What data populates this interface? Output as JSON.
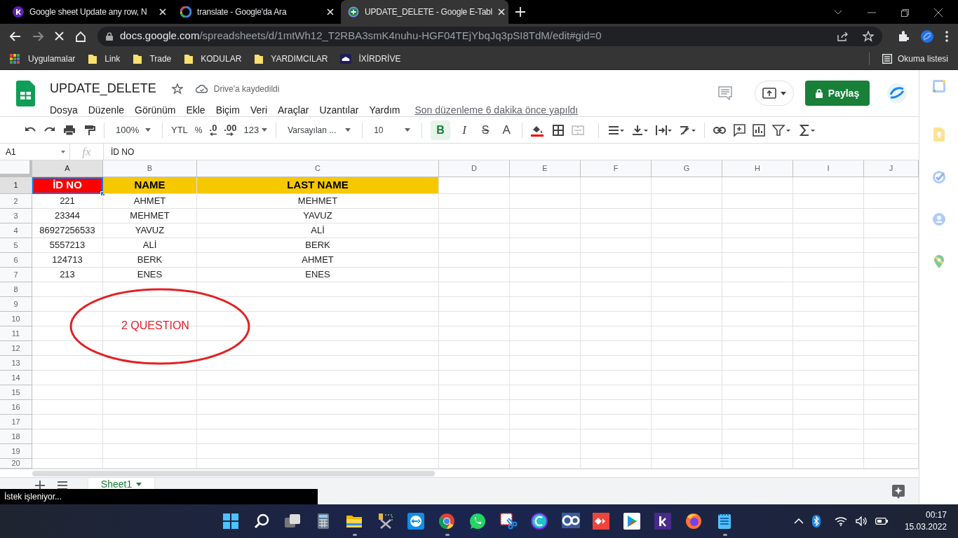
{
  "browser": {
    "tabs": [
      {
        "title": "Google sheet Update any row, N",
        "selected": false,
        "kind": "k"
      },
      {
        "title": "translate - Google'da Ara",
        "selected": false,
        "kind": "google"
      },
      {
        "title": "UPDATE_DELETE - Google E-Tabl",
        "selected": true,
        "kind": "sheets"
      }
    ],
    "url_host": "docs.google.com",
    "url_path": "/spreadsheets/d/1mtWh12_T2RBA3smK4nuhu-HGF04TEjYbqJq3pSI8TdM/edit#gid=0",
    "bookmarks": [
      {
        "label": "Uygulamalar",
        "kind": "apps"
      },
      {
        "label": "Link",
        "kind": "folder"
      },
      {
        "label": "Trade",
        "kind": "folder"
      },
      {
        "label": "KODULAR",
        "kind": "folder"
      },
      {
        "label": "YARDIMCILAR",
        "kind": "folder"
      },
      {
        "label": "İXİRDRİVE",
        "kind": "cloud"
      }
    ],
    "reading_list": "Okuma listesi"
  },
  "sheet": {
    "title": "UPDATE_DELETE",
    "save_status": "Drive'a kaydedildi",
    "menu": [
      "Dosya",
      "Düzenle",
      "Görünüm",
      "Ekle",
      "Biçim",
      "Veri",
      "Araçlar",
      "Uzantılar",
      "Yardım"
    ],
    "last_edit": "Son düzenleme 6 dakika önce yapıldı",
    "share": "Paylaş"
  },
  "toolbar": {
    "zoom": "100%",
    "currency": "YTL",
    "percent": "%",
    "decrease_decimals": ".0",
    "increase_decimals": ".00",
    "number_format": "123",
    "font": "Varsayılan ...",
    "font_size": "10",
    "bold": "B",
    "bold_on": true,
    "italic": "I",
    "strike": "S",
    "text_color": "A"
  },
  "formula_bar": {
    "cell": "A1",
    "fx": "fx",
    "value": "İD NO"
  },
  "columns": [
    {
      "label": "A",
      "selected": true
    },
    {
      "label": "B",
      "selected": false
    },
    {
      "label": "C",
      "selected": false
    },
    {
      "label": "D",
      "selected": false
    },
    {
      "label": "E",
      "selected": false
    },
    {
      "label": "F",
      "selected": false
    },
    {
      "label": "G",
      "selected": false
    },
    {
      "label": "H",
      "selected": false
    },
    {
      "label": "I",
      "selected": false
    },
    {
      "label": "J",
      "selected": false
    }
  ],
  "rows": [
    {
      "number": "1",
      "selected": true,
      "cells": [
        {
          "text": "İD NO",
          "color": "#ff0000",
          "selected": true
        },
        {
          "text": "NAME",
          "color": "#f5c800",
          "selected": false
        },
        {
          "text": "LAST NAME",
          "color": "#f5c800",
          "selected": false
        }
      ]
    },
    {
      "number": "2",
      "selected": false,
      "cells": [
        {
          "text": "221"
        },
        {
          "text": "AHMET"
        },
        {
          "text": "MEHMET"
        }
      ]
    },
    {
      "number": "3",
      "selected": false,
      "cells": [
        {
          "text": "23344"
        },
        {
          "text": "MEHMET"
        },
        {
          "text": "YAVUZ"
        }
      ]
    },
    {
      "number": "4",
      "selected": false,
      "cells": [
        {
          "text": "86927256533"
        },
        {
          "text": "YAVUZ"
        },
        {
          "text": "ALİ"
        }
      ]
    },
    {
      "number": "5",
      "selected": false,
      "cells": [
        {
          "text": "5557213"
        },
        {
          "text": "ALİ"
        },
        {
          "text": "BERK"
        }
      ]
    },
    {
      "number": "6",
      "selected": false,
      "cells": [
        {
          "text": "124713"
        },
        {
          "text": "BERK"
        },
        {
          "text": "AHMET"
        }
      ]
    },
    {
      "number": "7",
      "selected": false,
      "cells": [
        {
          "text": "213"
        },
        {
          "text": "ENES"
        },
        {
          "text": "ENES"
        }
      ]
    },
    {
      "number": "8",
      "selected": false
    },
    {
      "number": "9",
      "selected": false
    },
    {
      "number": "10",
      "selected": false
    },
    {
      "number": "11",
      "selected": false
    },
    {
      "number": "12",
      "selected": false
    },
    {
      "number": "13",
      "selected": false
    },
    {
      "number": "14",
      "selected": false
    },
    {
      "number": "15",
      "selected": false
    },
    {
      "number": "16",
      "selected": false
    },
    {
      "number": "17",
      "selected": false
    },
    {
      "number": "18",
      "selected": false
    },
    {
      "number": "19",
      "selected": false
    },
    {
      "number": "20",
      "selected": false
    }
  ],
  "annotation": {
    "text": "2 QUESTION"
  },
  "sheet_tabs": [
    {
      "label": "Sheet1",
      "selected": true
    }
  ],
  "status": "İstek işleniyor...",
  "taskbar": {
    "apps": [
      {
        "kind": "start",
        "running": false
      },
      {
        "kind": "search",
        "running": false
      },
      {
        "kind": "taskview",
        "running": false
      },
      {
        "kind": "calculator",
        "running": false
      },
      {
        "kind": "explorer",
        "running": true
      },
      {
        "kind": "tools",
        "running": false
      },
      {
        "kind": "teamviewer",
        "running": false
      },
      {
        "kind": "chrome",
        "running": true
      },
      {
        "kind": "whatsapp",
        "running": false
      },
      {
        "kind": "snip",
        "running": false
      },
      {
        "kind": "canva",
        "running": false
      },
      {
        "kind": "go",
        "running": false
      },
      {
        "kind": "anydesk",
        "running": false
      },
      {
        "kind": "play",
        "running": false
      },
      {
        "kind": "k",
        "running": false
      },
      {
        "kind": "firefox",
        "running": false
      },
      {
        "kind": "notepad",
        "running": true
      }
    ],
    "time": "00:17",
    "date": "15.03.2022"
  }
}
